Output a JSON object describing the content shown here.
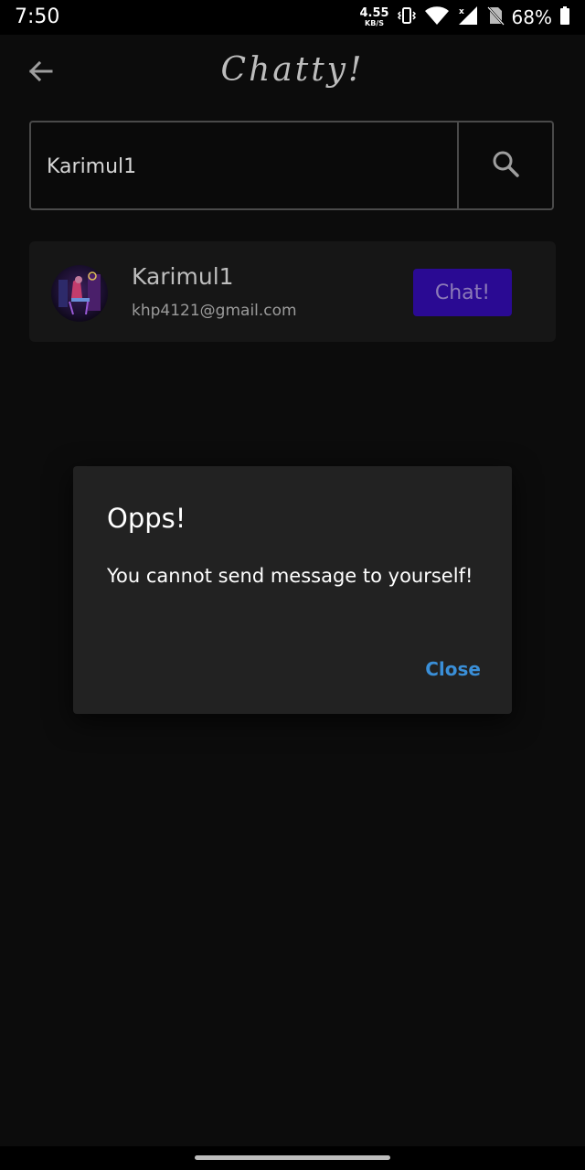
{
  "status_bar": {
    "time": "7:50",
    "net_speed_value": "4.55",
    "net_speed_unit": "KB/S",
    "battery_percent": "68%"
  },
  "app_bar": {
    "title": "Chatty!"
  },
  "search": {
    "value": "Karimul1",
    "placeholder": ""
  },
  "user_card": {
    "name": "Karimul1",
    "email": "khp4121@gmail.com",
    "chat_label": "Chat!"
  },
  "dialog": {
    "title": "Opps!",
    "message": "You cannot send message to yourself!",
    "close_label": "Close"
  },
  "colors": {
    "background": "#0c0c0c",
    "card": "#161616",
    "dialog": "#222222",
    "chat_button": "#2a0a93",
    "accent_link": "#3a8fd8"
  },
  "icons": [
    "vibrate-icon",
    "wifi-icon",
    "signal-icon",
    "no-sim-icon",
    "battery-icon",
    "back-arrow-icon",
    "search-icon"
  ]
}
